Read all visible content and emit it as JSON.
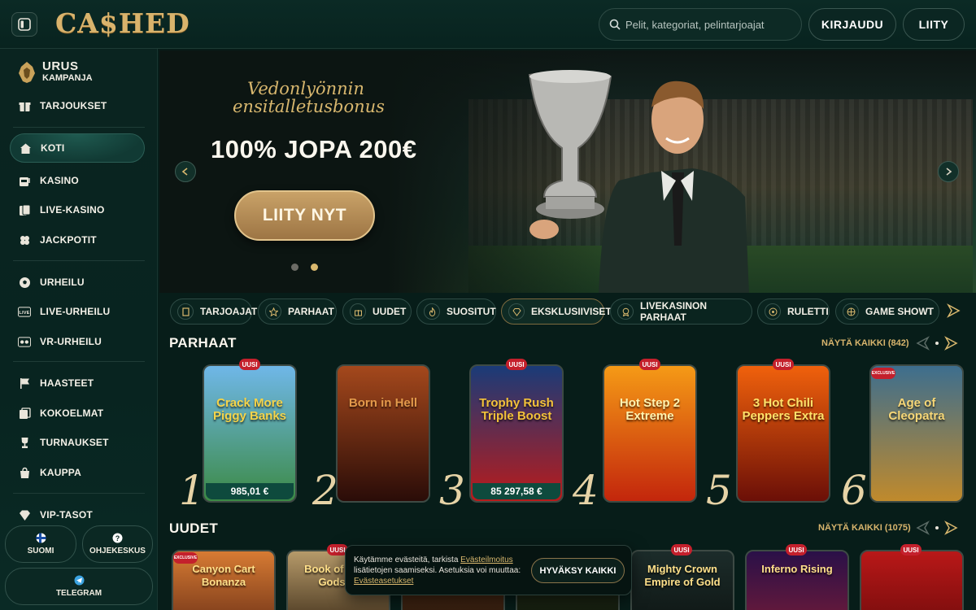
{
  "header": {
    "logo": "CA$HED",
    "search_placeholder": "Pelit, kategoriat, pelintarjoajat",
    "login_label": "KIRJAUDU",
    "join_label": "LIITY"
  },
  "sidebar": {
    "campaign_line1": "URUS",
    "campaign_line2": "KAMPANJA",
    "items": [
      {
        "label": "TARJOUKSET",
        "icon": "gift-icon"
      },
      {
        "label": "KOTI",
        "icon": "home-icon"
      },
      {
        "label": "KASINO",
        "icon": "slot-machine-icon"
      },
      {
        "label": "LIVE-KASINO",
        "icon": "cards-icon"
      },
      {
        "label": "JACKPOTIT",
        "icon": "clover-icon"
      },
      {
        "label": "URHEILU",
        "icon": "soccer-ball-icon"
      },
      {
        "label": "LIVE-URHEILU",
        "icon": "live-icon"
      },
      {
        "label": "VR-URHEILU",
        "icon": "vr-icon"
      },
      {
        "label": "HAASTEET",
        "icon": "flag-icon"
      },
      {
        "label": "KOKOELMAT",
        "icon": "album-icon"
      },
      {
        "label": "TURNAUKSET",
        "icon": "trophy-icon"
      },
      {
        "label": "KAUPPA",
        "icon": "shopping-bag-icon"
      },
      {
        "label": "VIP-TASOT",
        "icon": "diamond-icon"
      }
    ],
    "language_label": "SUOMI",
    "help_label": "OHJEKESKUS",
    "telegram_label": "TELEGRAM"
  },
  "hero": {
    "script_line1": "Vedonlyönnin",
    "script_line2": "ensitalletusbonus",
    "title": "100% JOPA 200€",
    "cta_label": "LIITY NYT"
  },
  "categories": [
    {
      "label": "TARJOAJAT",
      "icon": "book-icon"
    },
    {
      "label": "PARHAAT",
      "icon": "star-icon"
    },
    {
      "label": "UUDET",
      "icon": "gift-icon"
    },
    {
      "label": "SUOSITUT",
      "icon": "flame-icon"
    },
    {
      "label": "EKSKLUSIIVISET",
      "icon": "diamond-icon"
    },
    {
      "label": "LIVEKASINON PARHAAT",
      "icon": "medal-icon"
    },
    {
      "label": "RULETTI",
      "icon": "roulette-icon"
    },
    {
      "label": "GAME SHOWT",
      "icon": "wheel-icon"
    }
  ],
  "best": {
    "title": "PARHAAT",
    "see_all": "NÄYTÄ KAIKKI (842)",
    "games": [
      {
        "rank": "1",
        "name": "Crack More Piggy Banks",
        "badge": "UUSI",
        "price": "985,01 €",
        "color_top": "#6fb7e8",
        "color_bottom": "#3c8a45",
        "text_color": "#f5d44a"
      },
      {
        "rank": "2",
        "name": "Born in Hell",
        "badge": "",
        "price": "",
        "color_top": "#a4481c",
        "color_bottom": "#2a0c08",
        "text_color": "#e39a4b"
      },
      {
        "rank": "3",
        "name": "Trophy Rush Triple Boost",
        "badge": "UUSI",
        "price": "85 297,58 €",
        "color_top": "#1a3b78",
        "color_bottom": "#b91b1b",
        "text_color": "#f3c23a"
      },
      {
        "rank": "4",
        "name": "Hot Step 2 Extreme",
        "badge": "UUSI",
        "price": "",
        "color_top": "#f59a16",
        "color_bottom": "#c3260c",
        "text_color": "#fff3b0"
      },
      {
        "rank": "5",
        "name": "3 Hot Chili Peppers Extra",
        "badge": "UUSI",
        "price": "",
        "color_top": "#f0610c",
        "color_bottom": "#6b0f07",
        "text_color": "#ffe26a"
      },
      {
        "rank": "6",
        "name": "Age of Cleopatra",
        "badge": "EXCLUSIVE",
        "price": "",
        "color_top": "#3d6e8e",
        "color_bottom": "#c08a2c",
        "text_color": "#f7d777"
      }
    ]
  },
  "newest": {
    "title": "UUDET",
    "see_all": "NÄYTÄ KAIKKI (1075)",
    "games": [
      {
        "name": "Canyon Cart Bonanza",
        "badge": "EXCLUSIVE",
        "color_top": "#d77b33",
        "color_bottom": "#7a3a1a"
      },
      {
        "name": "Book of Demi Gods VI",
        "badge": "UUSI",
        "color_top": "#b69a6a",
        "color_bottom": "#4c3a22"
      },
      {
        "name": "",
        "badge": "",
        "color_top": "#6a3b1d",
        "color_bottom": "#2d1a0d"
      },
      {
        "name": "",
        "badge": "",
        "color_top": "#2c3a20",
        "color_bottom": "#121a0d"
      },
      {
        "name": "Mighty Crown Empire of Gold",
        "badge": "UUSI",
        "color_top": "#1c2c2a",
        "color_bottom": "#0f1715"
      },
      {
        "name": "Inferno Rising",
        "badge": "UUSI",
        "color_top": "#2a1048",
        "color_bottom": "#6a1a3a"
      },
      {
        "name": "",
        "badge": "UUSI",
        "color_top": "#b91818",
        "color_bottom": "#7a0d0d"
      }
    ]
  },
  "cookie": {
    "text_before": "Käytämme evästeitä, tarkista ",
    "link1": "Evästeilmoitus",
    "text_middle": " lisätietojen saamiseksi. Asetuksia voi muuttaa: ",
    "link2": "Evästeasetukset",
    "accept_label": "HYVÄKSY KAIKKI"
  }
}
